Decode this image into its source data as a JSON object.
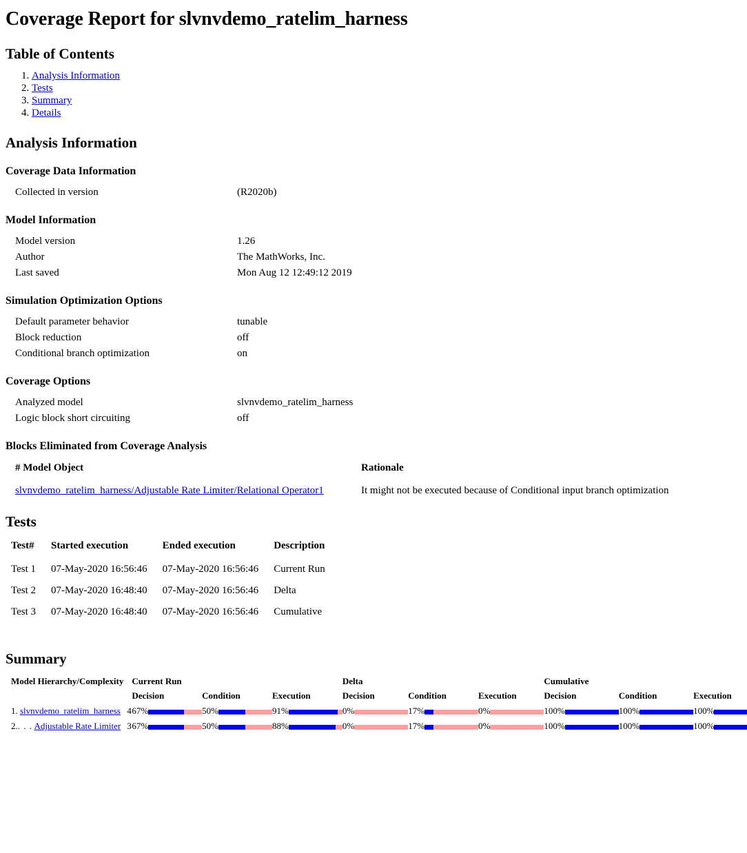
{
  "title": "Coverage Report for slvnvdemo_ratelim_harness",
  "toc": {
    "heading": "Table of Contents",
    "items": [
      {
        "label": "Analysis Information"
      },
      {
        "label": "Tests"
      },
      {
        "label": "Summary"
      },
      {
        "label": "Details"
      }
    ]
  },
  "analysis": {
    "heading": "Analysis Information",
    "coverage_data": {
      "heading": "Coverage Data Information",
      "rows": [
        {
          "key": "Collected in version",
          "value": "(R2020b)"
        }
      ]
    },
    "model_info": {
      "heading": "Model Information",
      "rows": [
        {
          "key": "Model version",
          "value": "1.26"
        },
        {
          "key": "Author",
          "value": "The MathWorks, Inc."
        },
        {
          "key": "Last saved",
          "value": "Mon Aug 12 12:49:12 2019"
        }
      ]
    },
    "sim_opt": {
      "heading": "Simulation Optimization Options",
      "rows": [
        {
          "key": "Default parameter behavior",
          "value": "tunable"
        },
        {
          "key": "Block reduction",
          "value": "off"
        },
        {
          "key": "Conditional branch optimization",
          "value": "on"
        }
      ]
    },
    "coverage_options": {
      "heading": "Coverage Options",
      "rows": [
        {
          "key": "Analyzed model",
          "value": "slvnvdemo_ratelim_harness"
        },
        {
          "key": "Logic block short circuiting",
          "value": "off"
        }
      ]
    },
    "blocks_eliminated": {
      "heading": "Blocks Eliminated from Coverage Analysis",
      "columns": {
        "object": "# Model Object",
        "rationale": "Rationale"
      },
      "rows": [
        {
          "object": "slvnvdemo_ratelim_harness/Adjustable Rate Limiter/Relational Operator1",
          "rationale": "It might not be executed because of Conditional input branch optimization"
        }
      ]
    }
  },
  "tests": {
    "heading": "Tests",
    "columns": [
      "Test#",
      "Started execution",
      "Ended execution",
      "Description"
    ],
    "rows": [
      {
        "id": "Test 1",
        "started": "07-May-2020 16:56:46",
        "ended": "07-May-2020 16:56:46",
        "description": "Current Run"
      },
      {
        "id": "Test 2",
        "started": "07-May-2020 16:48:40",
        "ended": "07-May-2020 16:56:46",
        "description": "Delta"
      },
      {
        "id": "Test 3",
        "started": "07-May-2020 16:48:40",
        "ended": "07-May-2020 16:56:46",
        "description": "Cumulative"
      }
    ]
  },
  "summary": {
    "heading": "Summary",
    "hierarchy_header": "Model Hierarchy/Complexity",
    "groups": [
      "Current Run",
      "Delta",
      "Cumulative"
    ],
    "metrics": [
      "Decision",
      "Condition",
      "Execution"
    ],
    "rows": [
      {
        "index": "1.",
        "indent": "",
        "name": "slvnvdemo_ratelim_harness",
        "complexity": "4",
        "current": {
          "decision": "67%",
          "condition": "50%",
          "execution": "91%"
        },
        "delta": {
          "decision": "0%",
          "condition": "17%",
          "execution": "0%"
        },
        "cumulative": {
          "decision": "100%",
          "condition": "100%",
          "execution": "100%"
        }
      },
      {
        "index": "2.",
        "indent": ". . .",
        "name": "Adjustable Rate Limiter",
        "complexity": "3",
        "current": {
          "decision": "67%",
          "condition": "50%",
          "execution": "88%"
        },
        "delta": {
          "decision": "0%",
          "condition": "17%",
          "execution": "0%"
        },
        "cumulative": {
          "decision": "100%",
          "condition": "100%",
          "execution": "100%"
        }
      }
    ]
  },
  "colors": {
    "bar_covered": "#0000ee",
    "bar_uncovered": "#ffa0a0",
    "link": "#0000cc"
  }
}
